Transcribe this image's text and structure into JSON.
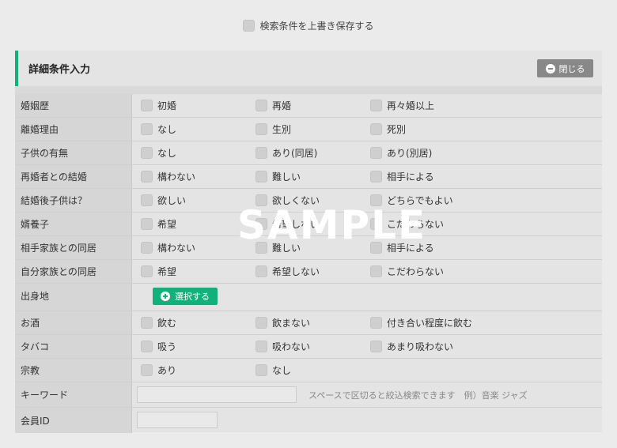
{
  "save_option": {
    "label": "検索条件を上書き保存する"
  },
  "panel": {
    "title": "詳細条件入力",
    "close_label": "閉じる"
  },
  "rows": [
    {
      "label": "婚姻歴",
      "options": [
        "初婚",
        "再婚",
        "再々婚以上"
      ]
    },
    {
      "label": "離婚理由",
      "options": [
        "なし",
        "生別",
        "死別"
      ]
    },
    {
      "label": "子供の有無",
      "options": [
        "なし",
        "あり(同居)",
        "あり(別居)"
      ]
    },
    {
      "label": "再婚者との結婚",
      "options": [
        "構わない",
        "難しい",
        "相手による"
      ]
    },
    {
      "label": "結婚後子供は？",
      "options": [
        "欲しい",
        "欲しくない",
        "どちらでもよい"
      ]
    },
    {
      "label": "婿養子",
      "options": [
        "希望",
        "希望しない",
        "こだわらない"
      ]
    },
    {
      "label": "相手家族との同居",
      "options": [
        "構わない",
        "難しい",
        "相手による"
      ]
    },
    {
      "label": "自分家族との同居",
      "options": [
        "希望",
        "希望しない",
        "こだわらない"
      ]
    },
    {
      "label": "出身地",
      "button": "選択する"
    },
    {
      "label": "お酒",
      "options": [
        "飲む",
        "飲まない",
        "付き合い程度に飲む"
      ]
    },
    {
      "label": "タバコ",
      "options": [
        "吸う",
        "吸わない",
        "あまり吸わない"
      ]
    },
    {
      "label": "宗教",
      "options": [
        "あり",
        "なし"
      ]
    },
    {
      "label": "キーワード",
      "input_value": "",
      "hint": "スペースで区切ると絞込検索できます　例）音楽 ジャズ"
    },
    {
      "label": "会員ID",
      "input_value": ""
    }
  ],
  "watermark": "SAMPLE",
  "colors": {
    "accent": "#12b07a",
    "close_button": "#888888",
    "label_bg": "#d6d6d6"
  }
}
